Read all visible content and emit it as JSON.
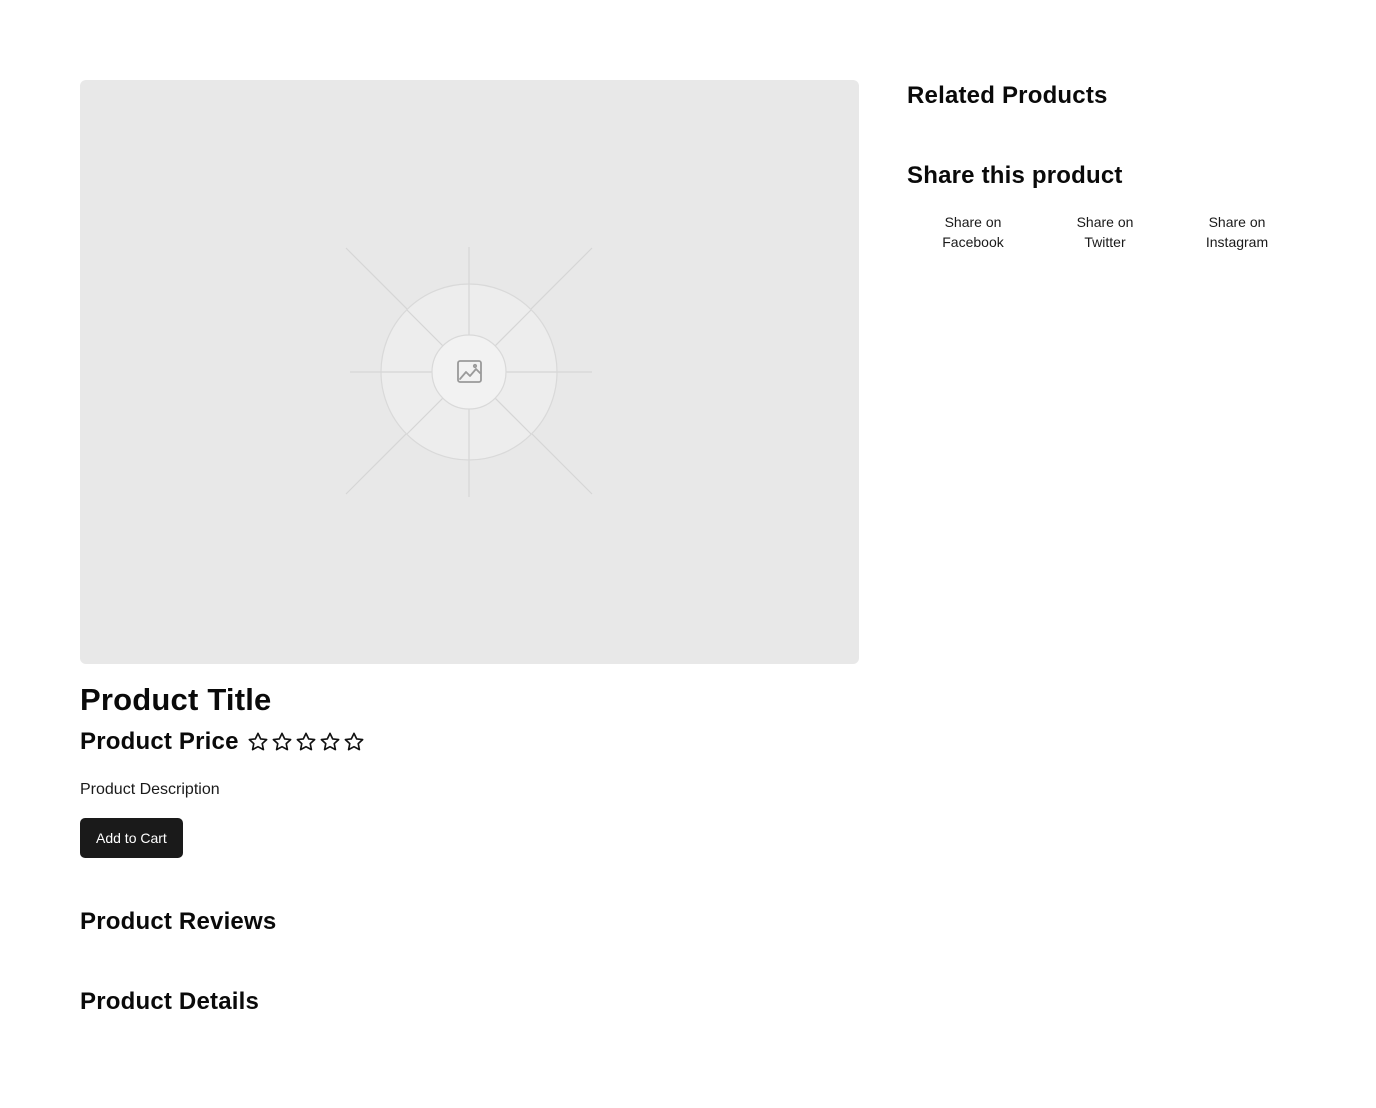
{
  "product": {
    "title": "Product Title",
    "price": "Product Price",
    "rating_stars_filled": 0,
    "rating_stars_total": 5,
    "description": "Product Description",
    "add_to_cart_label": "Add to Cart",
    "image_icon": "image-icon"
  },
  "sections": {
    "reviews_heading": "Product Reviews",
    "details_heading": "Product Details"
  },
  "sidebar": {
    "related_heading": "Related Products",
    "share_heading": "Share this product",
    "share_links": [
      {
        "line1": "Share on",
        "line2": "Facebook"
      },
      {
        "line1": "Share on",
        "line2": "Twitter"
      },
      {
        "line1": "Share on",
        "line2": "Instagram"
      }
    ]
  },
  "colors": {
    "button_bg": "#1a1a1a",
    "image_bg": "#e8e8e8",
    "text": "#0a0a0a"
  }
}
